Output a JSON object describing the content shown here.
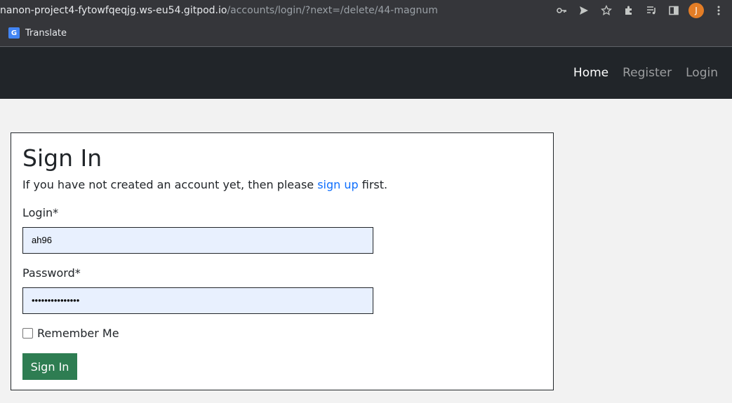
{
  "browser": {
    "url_host": "nanon-project4-fytowfqeqjg.ws-eu54.gitpod.io",
    "url_path": "/accounts/login/?next=/delete/44-magnum",
    "avatar_initial": "J",
    "bookmark_label": "Translate",
    "icons": [
      "key-icon",
      "send-icon",
      "star-icon",
      "extensions-icon",
      "media-icon",
      "sidepanel-icon",
      "menu-icon"
    ]
  },
  "nav": {
    "home": "Home",
    "register": "Register",
    "login": "Login"
  },
  "signin": {
    "title": "Sign In",
    "intro_before": "If you have not created an account yet, then please ",
    "intro_link": "sign up",
    "intro_after": " first.",
    "login_label": "Login*",
    "login_value": "ah96",
    "password_label": "Password*",
    "password_value": "•••••••••••••••",
    "remember_label": "Remember Me",
    "submit_label": "Sign In"
  },
  "colors": {
    "navbar_bg": "#212529",
    "button_bg": "#2e7d52",
    "link": "#0d6efd",
    "autofill_bg": "#e8f0fe"
  }
}
